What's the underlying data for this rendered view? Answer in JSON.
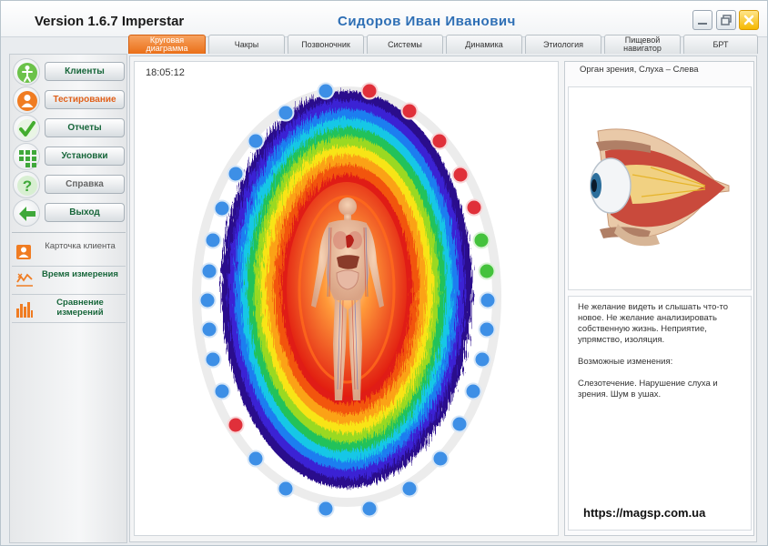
{
  "window": {
    "app_title": "Version 1.6.7 Imperstar",
    "patient_name": "Сидоров  Иван  Иванович",
    "controls": [
      "minimize-icon",
      "restore-icon",
      "close-icon"
    ]
  },
  "tabs": [
    {
      "label": "Круговая диаграмма",
      "active": true
    },
    {
      "label": "Чакры"
    },
    {
      "label": "Позвоночник"
    },
    {
      "label": "Системы"
    },
    {
      "label": "Динамика"
    },
    {
      "label": "Этиология"
    },
    {
      "label": "Пищевой навигатор"
    },
    {
      "label": "БРТ"
    }
  ],
  "nav": [
    {
      "label": "Клиенты",
      "icon": "person-icon"
    },
    {
      "label": "Тестирование",
      "icon": "user-orange-icon",
      "active": true
    },
    {
      "label": "Отчеты",
      "icon": "checkmark-icon"
    },
    {
      "label": "Установки",
      "icon": "grid-settings-icon"
    },
    {
      "label": "Справка",
      "icon": "help-icon"
    },
    {
      "label": "Выход",
      "icon": "exit-arrow-icon"
    }
  ],
  "subnav": [
    {
      "label": "Карточка клиента",
      "icon": "client-card-icon"
    },
    {
      "label": "Время измерения",
      "icon": "measure-time-icon"
    },
    {
      "label": "Сравнение измерений",
      "icon": "compare-bars-icon"
    }
  ],
  "diagram": {
    "timestamp": "18:05:12",
    "point_colors": {
      "blue": "#3d8fe6",
      "red": "#e0303a",
      "green": "#44c23c"
    }
  },
  "info": {
    "organ_title": "Орган зрения, Слуха – Слева",
    "description": "Не желание видеть и слышать что-то новое. Не желание анализировать собственную жизнь. Неприятие, упрямство, изоляция.",
    "changes_heading": "Возможные изменения:",
    "changes": "Слезотечение. Нарушение слуха и зрения. Шум в ушах."
  },
  "watermark": "https://magsp.com.ua",
  "colors": {
    "accent_orange": "#ea6f18",
    "nav_green": "#17663a",
    "title_blue": "#2e6fb5"
  }
}
